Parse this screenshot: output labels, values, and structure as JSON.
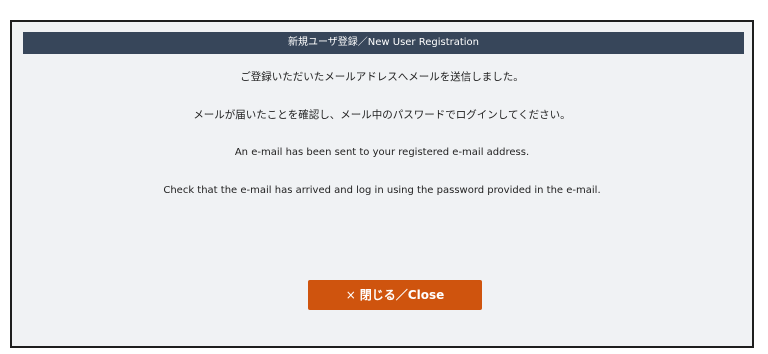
{
  "dialog": {
    "title": "新規ユーザ登録／New User Registration",
    "messages": {
      "jp_sent": "ご登録いただいたメールアドレスへメールを送信しました。",
      "jp_login": "メールが届いたことを確認し、メール中のパスワードでログインしてください。",
      "en_sent": "An e-mail has been sent to your registered e-mail address.",
      "en_login": "Check that the e-mail has arrived and log in using the password provided in the e-mail."
    },
    "close_button": {
      "icon": "×",
      "label": "閉じる／Close"
    }
  },
  "colors": {
    "titlebar": "#37465a",
    "dialog_background": "#f0f2f4",
    "button": "#cf540e"
  }
}
